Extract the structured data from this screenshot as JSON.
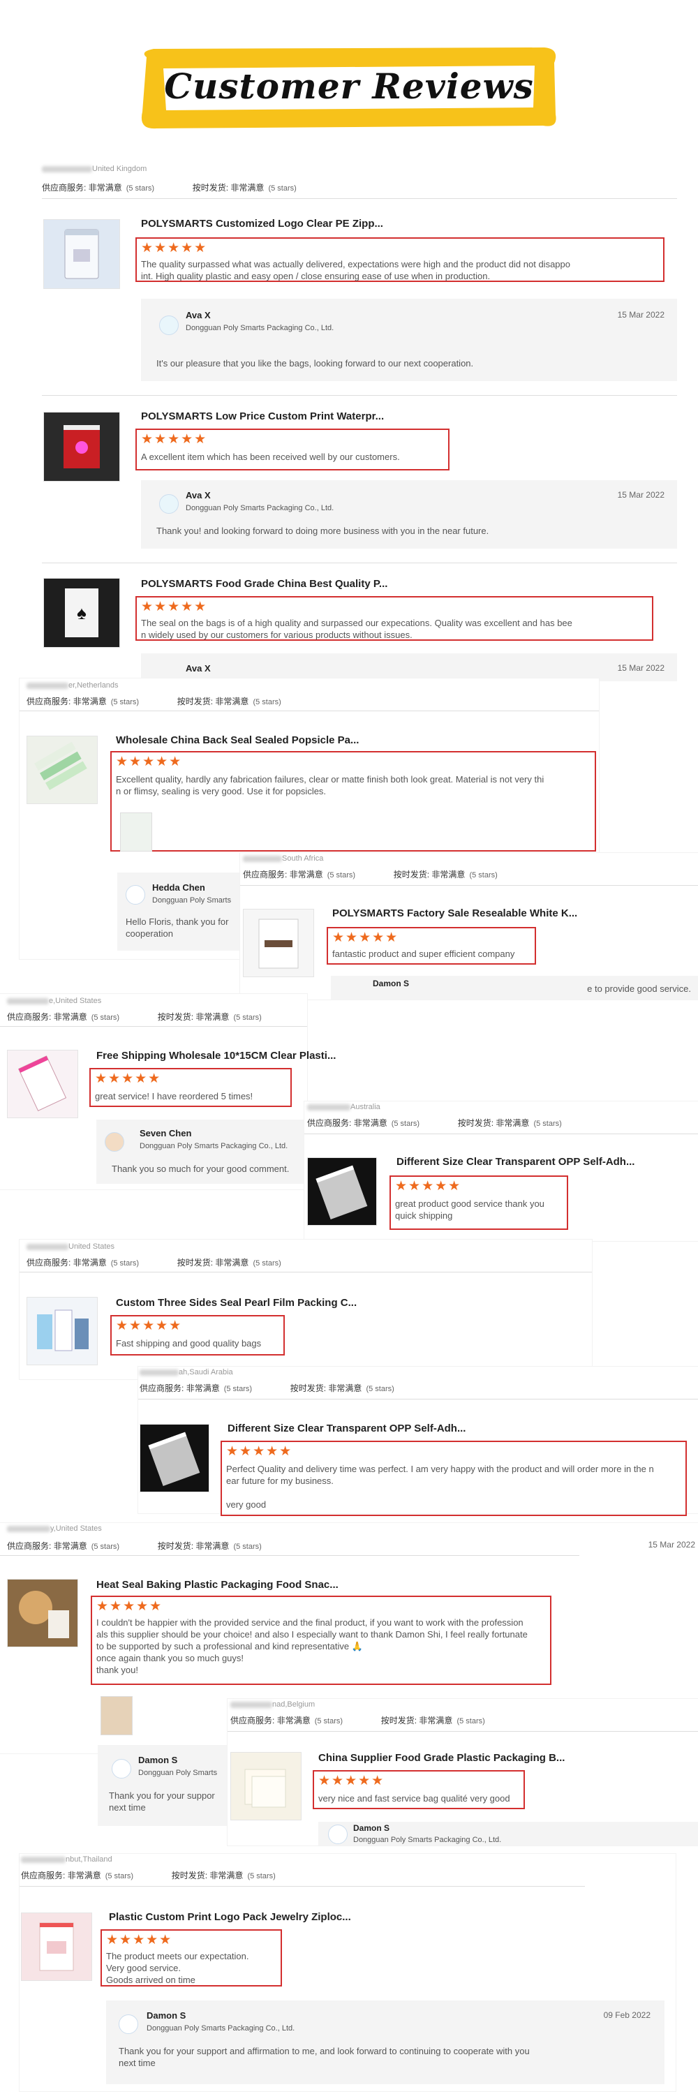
{
  "banner": {
    "title": "Customer Reviews"
  },
  "labels": {
    "supplier_service": "供应商服务:",
    "very_satisfied": "非常满意",
    "five_stars": "(5 stars)",
    "on_time": "按时发货:",
    "stars_glyph": "★★★★★"
  },
  "reviews": [
    {
      "country": "United Kingdom",
      "product": "POLYSMARTS Customized Logo Clear PE Zipp...",
      "text": "The quality surpassed what was actually delivered, expectations were high and the product did not disappo\nint. High quality plastic and easy open / close ensuring ease of use when in production.",
      "reply": {
        "name": "Ava X",
        "company": "Dongguan Poly Smarts Packaging Co., Ltd.",
        "date": "15 Mar 2022",
        "text": "It's our pleasure that you like the bags, looking forward to our next cooperation."
      }
    },
    {
      "product": "POLYSMARTS Low Price Custom Print Waterpr...",
      "text": "A excellent item which has been received well by our customers.",
      "reply": {
        "name": "Ava X",
        "company": "Dongguan Poly Smarts Packaging Co., Ltd.",
        "date": "15 Mar 2022",
        "text": "Thank you!  and looking forward to doing more business with you in the near future."
      }
    },
    {
      "product": "POLYSMARTS Food Grade China Best Quality P...",
      "text": "The seal on the bags is of a high quality and surpassed our expecations. Quality was excellent and has bee\nn widely used by our customers for various products without issues.",
      "reply": {
        "name": "Ava X",
        "date": "15 Mar 2022"
      }
    },
    {
      "country": "er,Netherlands",
      "product": "Wholesale China Back Seal Sealed Popsicle Pa...",
      "text": "Excellent quality, hardly any fabrication failures, clear or matte finish both look great. Material is not very thi\nn or flimsy, sealing is very good. Use it for popsicles.",
      "reply": {
        "name": "Hedda Chen",
        "company": "Dongguan Poly Smarts",
        "text": "Hello Floris, thank you for\ncooperation"
      }
    },
    {
      "country": "South Africa",
      "product": "POLYSMARTS Factory Sale Resealable White K...",
      "text": "fantastic product and super efficient company",
      "reply": {
        "name": "Damon S",
        "text": "e to provide good service."
      }
    },
    {
      "country": "e,United States",
      "product": "Free Shipping Wholesale 10*15CM Clear Plasti...",
      "text": "great service! I have reordered 5 times!",
      "reply": {
        "name": "Seven Chen",
        "company": "Dongguan Poly Smarts Packaging Co., Ltd.",
        "text": "Thank you so much for your good comment."
      }
    },
    {
      "country": "Australia",
      "product": "Different Size Clear Transparent OPP Self-Adh...",
      "text": "great product good service thank you\nquick shipping"
    },
    {
      "country": "United States",
      "product": "Custom Three Sides Seal Pearl Film Packing C...",
      "text": "Fast shipping and good quality bags"
    },
    {
      "country": "ah,Saudi Arabia",
      "product": "Different Size Clear Transparent OPP Self-Adh...",
      "text": "Perfect Quality and delivery time was perfect. I am very happy with the product and will order more in the n\near future for my business.\n\nvery good"
    },
    {
      "country": "y,United States",
      "date_right": "15 Mar 2022",
      "product": "Heat Seal Baking Plastic Packaging Food Snac...",
      "text": "I couldn't be happier with the provided service and the final product, if you want to work with the profession\nals this supplier should be your choice! and also I especially want to thank Damon Shi, I feel really fortunate\nto be supported by such a professional and kind representative 🙏\nonce again thank you so much guys!\nthank you!",
      "reply": {
        "name": "Damon S",
        "company": "Dongguan Poly Smarts",
        "text": "Thank you for your suppor\nnext time"
      }
    },
    {
      "country": "nad,Belgium",
      "product": "China Supplier Food Grade Plastic Packaging B...",
      "text": "very nice and fast service bag qualité very good",
      "reply": {
        "name": "Damon S",
        "company": "Dongguan Poly Smarts Packaging Co., Ltd."
      }
    },
    {
      "country": "nbut,Thailand",
      "product": "Plastic Custom Print Logo Pack Jewelry Ziploc...",
      "text": "The product meets our expectation.\nVery good service.\nGoods arrived on time",
      "reply": {
        "name": "Damon S",
        "company": "Dongguan Poly Smarts Packaging Co., Ltd.",
        "date": "09 Feb 2022",
        "text": "Thank you for your support and affirmation to me, and look forward to continuing to cooperate with you\nnext time"
      }
    }
  ],
  "colors": {
    "highlight": "#d32f2f",
    "star": "#ee6a1e",
    "banner_yellow": "#f7c21a"
  }
}
